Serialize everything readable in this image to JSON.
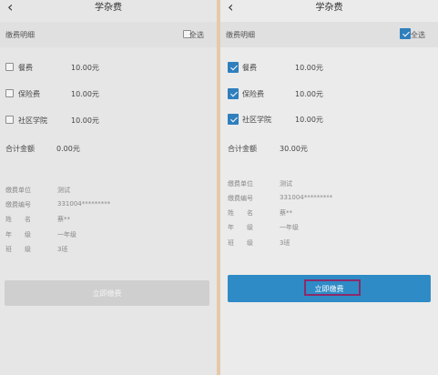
{
  "left": {
    "title": "学杂费",
    "back_glyph": "‹",
    "section_label": "缴费明细",
    "select_all_label": "全选",
    "select_all_checked": false,
    "items": [
      {
        "name": "餐费",
        "amount": "10.00元",
        "checked": false
      },
      {
        "name": "保险费",
        "amount": "10.00元",
        "checked": false
      },
      {
        "name": "社区学院",
        "amount": "10.00元",
        "checked": false
      }
    ],
    "total_label": "合计金额",
    "total_value": "0.00元",
    "info": [
      {
        "key": "缴费单位",
        "value": "测试"
      },
      {
        "key": "缴费编号",
        "value": "331004*********"
      },
      {
        "key": "姓　　名",
        "value": "蔡**"
      },
      {
        "key": "年　　级",
        "value": "一年级"
      },
      {
        "key": "班　　级",
        "value": "3班"
      }
    ],
    "pay_button": "立即缴费",
    "pay_enabled": false
  },
  "right": {
    "title": "学杂费",
    "back_glyph": "‹",
    "section_label": "缴费明细",
    "select_all_label": "全选",
    "select_all_checked": true,
    "items": [
      {
        "name": "餐费",
        "amount": "10.00元",
        "checked": true
      },
      {
        "name": "保险费",
        "amount": "10.00元",
        "checked": true
      },
      {
        "name": "社区学院",
        "amount": "10.00元",
        "checked": true
      }
    ],
    "total_label": "合计金额",
    "total_value": "30.00元",
    "info": [
      {
        "key": "缴费单位",
        "value": "测试"
      },
      {
        "key": "缴费编号",
        "value": "331004*********"
      },
      {
        "key": "姓　　名",
        "value": "蔡**"
      },
      {
        "key": "年　　级",
        "value": "一年级"
      },
      {
        "key": "班　　级",
        "value": "3班"
      }
    ],
    "pay_button": "立即缴费",
    "pay_enabled": true
  },
  "colors": {
    "accent": "#2e8bc6",
    "checkbox_checked": "#2f7fbd",
    "disabled_button": "#cfcfcf",
    "highlight_border": "#8b2a6a"
  }
}
